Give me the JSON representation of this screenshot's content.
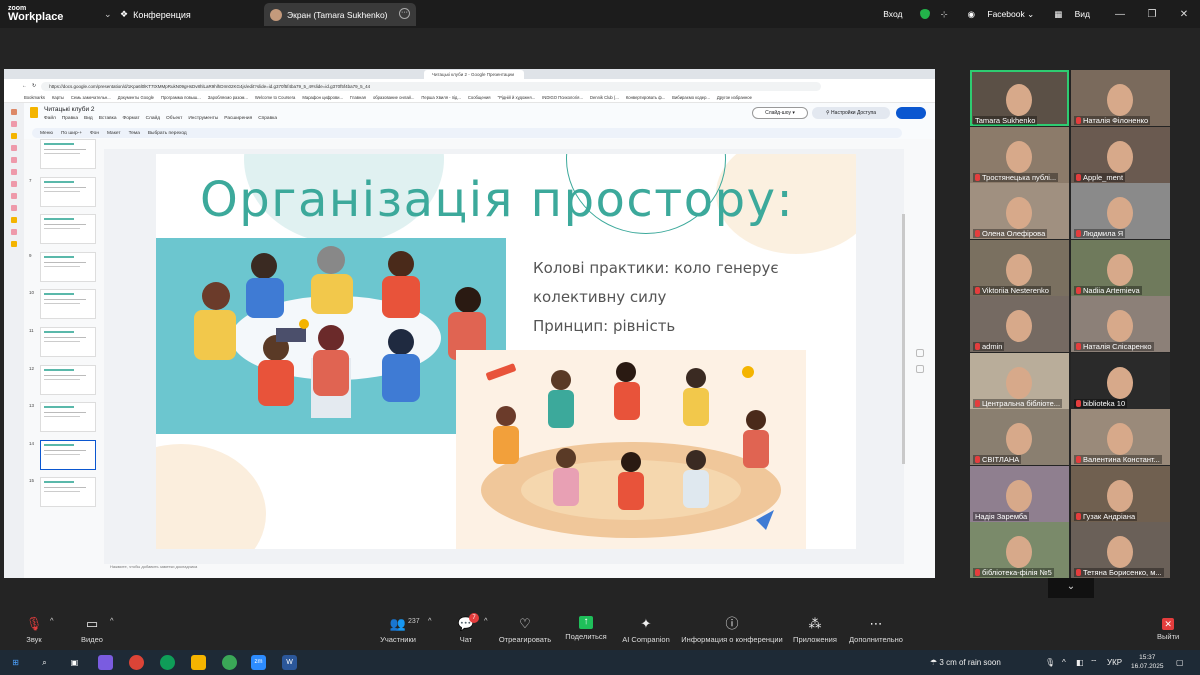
{
  "zoom": {
    "logo_top": "zoom",
    "logo_bottom": "Workplace",
    "conference_label": "Конференция",
    "screen_tab": "Экран (Tamara Sukhenko)",
    "login": "Вход",
    "facebook": "Facebook",
    "view": "Вид"
  },
  "browser": {
    "tab_title": "Читацькі клуби 2 - Google Презентации",
    "url": "https://docs.google.com/presentation/d/1Kpa6l0lKT7tXMMpRukN09gHsDv8hlLaR9hlhDIm02KG4js/edit?slide=id.g370f5f4ba79_5_4#slide=id.g370f5f4ba79_5_44",
    "bookmarks": [
      "Bookmarks",
      "Карты",
      "Семь замечательн...",
      "Документы Google",
      "Программа повыш...",
      "Заробляємо разом...",
      "Welcome to Coursera",
      "Марафон цифрови...",
      "Главная",
      "образование онлай...",
      "Перша Хвиля - під...",
      "Сообщения",
      "\"Рідній й художня...",
      "INDIGO Психологія...",
      "Dennik Club (...",
      "Конвертировать ф...",
      "Вибираємо кодер...",
      "Другое избранное"
    ]
  },
  "slides_app": {
    "doc_title": "Читацькі клуби 2",
    "menu": [
      "Файл",
      "Правка",
      "Вид",
      "Вставка",
      "Формат",
      "Слайд",
      "Объект",
      "Инструменты",
      "Расширения",
      "Справка"
    ],
    "slideshow_button": "Слайд-шоу",
    "access_button": "Настройки Доступа",
    "toolbar": [
      "Меню",
      "По шир-+",
      "Фон",
      "Макет",
      "Тема",
      "Выбрать переход"
    ],
    "notes_placeholder": "Нажмите, чтобы добавить заметки докладчика"
  },
  "filmstrip": {
    "numbers": [
      "",
      "7",
      "",
      "9",
      "10",
      "11",
      "12",
      "13",
      "14",
      "15"
    ],
    "selected_index": 8
  },
  "slide": {
    "title": "Організація простору:",
    "bullets": [
      "Колові практики:  коло генерує",
      "колективну силу",
      "Принцип:  рівність"
    ]
  },
  "participants": [
    {
      "name": "Tamara Sukhenko",
      "muted": false,
      "active": true
    },
    {
      "name": "Наталія Філоненко",
      "muted": true
    },
    {
      "name": "Тростянецька публі...",
      "muted": true
    },
    {
      "name": "Apple_ment",
      "muted": true
    },
    {
      "name": "Олена Олефірова",
      "muted": true
    },
    {
      "name": "Людмила Я",
      "muted": true
    },
    {
      "name": "Viktoriia Nesterenko",
      "muted": true
    },
    {
      "name": "Nadiia Artemieva",
      "muted": true
    },
    {
      "name": "admin",
      "muted": true
    },
    {
      "name": "Наталія Слісаренко",
      "muted": true
    },
    {
      "name": "Центральна бібліоте...",
      "muted": true
    },
    {
      "name": "biblioteka 10",
      "muted": true
    },
    {
      "name": "СВІТЛАНА",
      "muted": true
    },
    {
      "name": "Валентина Констант...",
      "muted": true
    },
    {
      "name": "Надія Заремба",
      "muted": false
    },
    {
      "name": "Гузак Андріана",
      "muted": true
    },
    {
      "name": "бібліотека-філія №5",
      "muted": true
    },
    {
      "name": "Тетяна Борисенко, м...",
      "muted": true
    }
  ],
  "controls": {
    "audio": "Звук",
    "video": "Видео",
    "participants": "Участники",
    "participants_count": "237",
    "chat": "Чат",
    "chat_badge": "7",
    "react": "Отреагировать",
    "share": "Поделиться",
    "ai": "AI Companion",
    "info": "Информация о конференции",
    "apps": "Приложения",
    "more": "Дополнительно",
    "leave": "Выйти"
  },
  "taskbar": {
    "weather": "3 cm of rain soon",
    "lang": "УКР",
    "time": "15:37",
    "date": "16.07.2025"
  },
  "colors": {
    "accent_teal": "#3ca99b",
    "zoom_green": "#1fbf5a",
    "alert_red": "#e43d3d",
    "google_blue": "#0b57d0"
  }
}
